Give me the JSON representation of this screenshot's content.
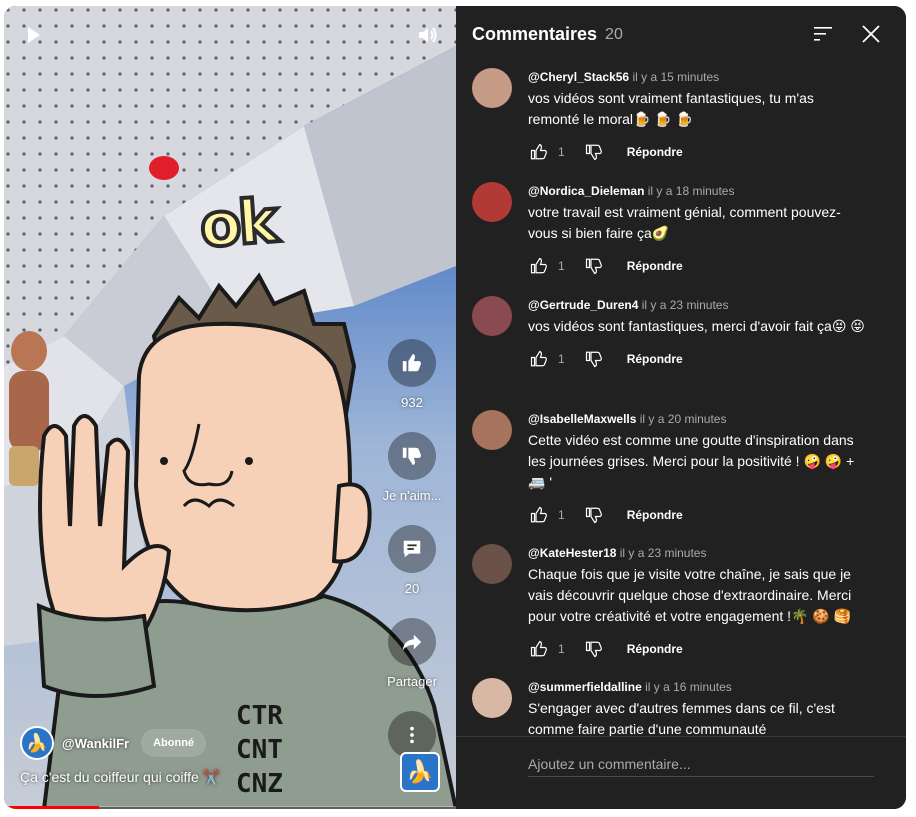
{
  "video": {
    "overlay_text": "ok",
    "shirt_text": [
      "CTR",
      "CNT",
      "CNZ"
    ],
    "actions": {
      "like_count": "932",
      "dislike_label": "Je n'aim...",
      "comments_count": "20",
      "share_label": "Partager"
    },
    "channel": {
      "handle": "@WankilFr",
      "subscribe_label": "Abonné",
      "avatar_emoji": "🍌"
    },
    "title": "Ça c'est du coiffeur qui coiffe ✂️",
    "progress": 0.21
  },
  "comments_panel": {
    "title": "Commentaires",
    "count": "20",
    "reply_label": "Répondre",
    "input_placeholder": "Ajoutez un commentaire...",
    "comments": [
      {
        "author": "@Cheryl_Stack56",
        "time": "il y a 15 minutes",
        "text": "vos vidéos sont vraiment fantastiques,  tu m'as remonté le moral🍺 🍺 🍺",
        "likes": "1",
        "avatar_color": "#c79c86"
      },
      {
        "author": "@Nordica_Dieleman",
        "time": "il y a 18 minutes",
        "text": "votre travail est vraiment génial, comment pouvez-vous si bien faire ça🥑",
        "likes": "1",
        "avatar_color": "#b23a36"
      },
      {
        "author": "@Gertrude_Duren4",
        "time": "il y a 23 minutes",
        "text": "vos vidéos sont fantastiques, merci d'avoir fait ça😝 😝",
        "likes": "1",
        "avatar_color": "#8a4a52"
      },
      {
        "author": "@IsabelleMaxwells",
        "time": "il y a 20 minutes",
        "text": "Cette vidéo est comme une goutte d'inspiration dans les journées grises. Merci pour la positivité ! 🤪 🤪 + 🚐 '",
        "likes": "1",
        "avatar_color": "#a8735c"
      },
      {
        "author": "@KateHester18",
        "time": "il y a 23 minutes",
        "text": "Chaque fois que je visite votre chaîne, je sais que je vais découvrir quelque chose d'extraordinaire. Merci pour votre créativité et votre engagement !🌴 🍪 🥞",
        "likes": "1",
        "avatar_color": "#6b5148"
      },
      {
        "author": "@summerfieldalline",
        "time": "il y a 16 minutes",
        "text": "S'engager avec d'autres femmes dans ce fil, c'est comme faire partie d'une communauté",
        "likes": "",
        "avatar_color": "#d8b8a4"
      }
    ]
  },
  "colors": {
    "panel_bg": "#212121",
    "text_primary": "#ffffff",
    "text_secondary": "#aaaaaa",
    "progress": "#ff0000"
  }
}
